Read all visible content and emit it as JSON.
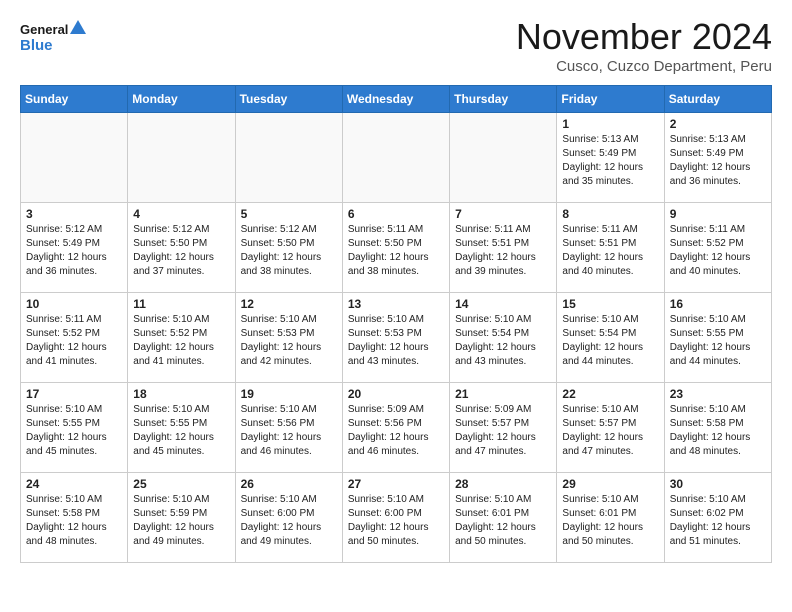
{
  "header": {
    "logo_line1": "General",
    "logo_line2": "Blue",
    "month_title": "November 2024",
    "location": "Cusco, Cuzco Department, Peru"
  },
  "weekdays": [
    "Sunday",
    "Monday",
    "Tuesday",
    "Wednesday",
    "Thursday",
    "Friday",
    "Saturday"
  ],
  "weeks": [
    [
      {
        "day": "",
        "empty": true
      },
      {
        "day": "",
        "empty": true
      },
      {
        "day": "",
        "empty": true
      },
      {
        "day": "",
        "empty": true
      },
      {
        "day": "",
        "empty": true
      },
      {
        "day": "1",
        "info": "Sunrise: 5:13 AM\nSunset: 5:49 PM\nDaylight: 12 hours\nand 35 minutes."
      },
      {
        "day": "2",
        "info": "Sunrise: 5:13 AM\nSunset: 5:49 PM\nDaylight: 12 hours\nand 36 minutes."
      }
    ],
    [
      {
        "day": "3",
        "info": "Sunrise: 5:12 AM\nSunset: 5:49 PM\nDaylight: 12 hours\nand 36 minutes."
      },
      {
        "day": "4",
        "info": "Sunrise: 5:12 AM\nSunset: 5:50 PM\nDaylight: 12 hours\nand 37 minutes."
      },
      {
        "day": "5",
        "info": "Sunrise: 5:12 AM\nSunset: 5:50 PM\nDaylight: 12 hours\nand 38 minutes."
      },
      {
        "day": "6",
        "info": "Sunrise: 5:11 AM\nSunset: 5:50 PM\nDaylight: 12 hours\nand 38 minutes."
      },
      {
        "day": "7",
        "info": "Sunrise: 5:11 AM\nSunset: 5:51 PM\nDaylight: 12 hours\nand 39 minutes."
      },
      {
        "day": "8",
        "info": "Sunrise: 5:11 AM\nSunset: 5:51 PM\nDaylight: 12 hours\nand 40 minutes."
      },
      {
        "day": "9",
        "info": "Sunrise: 5:11 AM\nSunset: 5:52 PM\nDaylight: 12 hours\nand 40 minutes."
      }
    ],
    [
      {
        "day": "10",
        "info": "Sunrise: 5:11 AM\nSunset: 5:52 PM\nDaylight: 12 hours\nand 41 minutes."
      },
      {
        "day": "11",
        "info": "Sunrise: 5:10 AM\nSunset: 5:52 PM\nDaylight: 12 hours\nand 41 minutes."
      },
      {
        "day": "12",
        "info": "Sunrise: 5:10 AM\nSunset: 5:53 PM\nDaylight: 12 hours\nand 42 minutes."
      },
      {
        "day": "13",
        "info": "Sunrise: 5:10 AM\nSunset: 5:53 PM\nDaylight: 12 hours\nand 43 minutes."
      },
      {
        "day": "14",
        "info": "Sunrise: 5:10 AM\nSunset: 5:54 PM\nDaylight: 12 hours\nand 43 minutes."
      },
      {
        "day": "15",
        "info": "Sunrise: 5:10 AM\nSunset: 5:54 PM\nDaylight: 12 hours\nand 44 minutes."
      },
      {
        "day": "16",
        "info": "Sunrise: 5:10 AM\nSunset: 5:55 PM\nDaylight: 12 hours\nand 44 minutes."
      }
    ],
    [
      {
        "day": "17",
        "info": "Sunrise: 5:10 AM\nSunset: 5:55 PM\nDaylight: 12 hours\nand 45 minutes."
      },
      {
        "day": "18",
        "info": "Sunrise: 5:10 AM\nSunset: 5:55 PM\nDaylight: 12 hours\nand 45 minutes."
      },
      {
        "day": "19",
        "info": "Sunrise: 5:10 AM\nSunset: 5:56 PM\nDaylight: 12 hours\nand 46 minutes."
      },
      {
        "day": "20",
        "info": "Sunrise: 5:09 AM\nSunset: 5:56 PM\nDaylight: 12 hours\nand 46 minutes."
      },
      {
        "day": "21",
        "info": "Sunrise: 5:09 AM\nSunset: 5:57 PM\nDaylight: 12 hours\nand 47 minutes."
      },
      {
        "day": "22",
        "info": "Sunrise: 5:10 AM\nSunset: 5:57 PM\nDaylight: 12 hours\nand 47 minutes."
      },
      {
        "day": "23",
        "info": "Sunrise: 5:10 AM\nSunset: 5:58 PM\nDaylight: 12 hours\nand 48 minutes."
      }
    ],
    [
      {
        "day": "24",
        "info": "Sunrise: 5:10 AM\nSunset: 5:58 PM\nDaylight: 12 hours\nand 48 minutes."
      },
      {
        "day": "25",
        "info": "Sunrise: 5:10 AM\nSunset: 5:59 PM\nDaylight: 12 hours\nand 49 minutes."
      },
      {
        "day": "26",
        "info": "Sunrise: 5:10 AM\nSunset: 6:00 PM\nDaylight: 12 hours\nand 49 minutes."
      },
      {
        "day": "27",
        "info": "Sunrise: 5:10 AM\nSunset: 6:00 PM\nDaylight: 12 hours\nand 50 minutes."
      },
      {
        "day": "28",
        "info": "Sunrise: 5:10 AM\nSunset: 6:01 PM\nDaylight: 12 hours\nand 50 minutes."
      },
      {
        "day": "29",
        "info": "Sunrise: 5:10 AM\nSunset: 6:01 PM\nDaylight: 12 hours\nand 50 minutes."
      },
      {
        "day": "30",
        "info": "Sunrise: 5:10 AM\nSunset: 6:02 PM\nDaylight: 12 hours\nand 51 minutes."
      }
    ]
  ]
}
